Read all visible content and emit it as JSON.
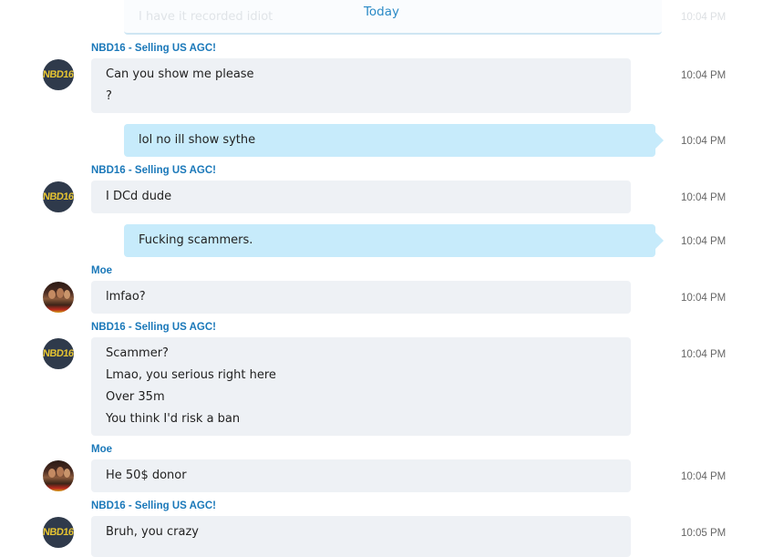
{
  "header": {
    "date_divider": "Today",
    "partial_message": "I have it recorded idiot",
    "partial_time": "10:04 PM"
  },
  "participants": {
    "nbd16": "NBD16 - Selling US AGC!",
    "moe": "Moe",
    "nbd16_avatar_text": "NBD16"
  },
  "messages": [
    {
      "sender": "NBD16 - Selling US AGC!",
      "lines": [
        "Can you show me please",
        "?"
      ],
      "time": "10:04 PM"
    },
    {
      "sender": "",
      "lines": [
        "lol no ill show sythe"
      ],
      "time": "10:04 PM"
    },
    {
      "sender": "NBD16 - Selling US AGC!",
      "lines": [
        "I DCd dude"
      ],
      "time": "10:04 PM"
    },
    {
      "sender": "",
      "lines": [
        "Fucking scammers."
      ],
      "time": "10:04 PM"
    },
    {
      "sender": "Moe",
      "lines": [
        "lmfao?"
      ],
      "time": "10:04 PM"
    },
    {
      "sender": "NBD16 - Selling US AGC!",
      "lines": [
        "Scammer?",
        "Lmao, you serious right here",
        "Over 35m",
        "You think I'd risk a ban"
      ],
      "time": "10:04 PM"
    },
    {
      "sender": "Moe",
      "lines": [
        "He 50$ donor"
      ],
      "time": "10:04 PM"
    },
    {
      "sender": "NBD16 - Selling US AGC!",
      "lines": [
        "Bruh, you crazy"
      ],
      "time": "10:05 PM"
    }
  ],
  "colors": {
    "incoming_bubble": "#eef1f5",
    "outgoing_bubble": "#c7ebfb",
    "sender_name": "#1a78b9",
    "divider": "#2a8ac6"
  }
}
